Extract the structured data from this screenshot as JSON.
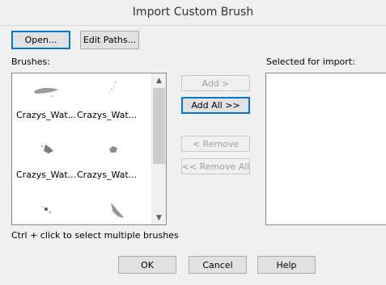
{
  "window": {
    "title": "Import Custom Brush"
  },
  "toolbar": {
    "open_label": "Open...",
    "edit_paths_label": "Edit Paths..."
  },
  "brushes": {
    "label": "Brushes:",
    "items": [
      {
        "name": "Crazys_Wat...",
        "icon": "brush-stroke-thumbnail"
      },
      {
        "name": "Crazys_Wat...",
        "icon": "brush-splatter-thumbnail"
      },
      {
        "name": "Crazys_Wat...",
        "icon": "brush-blot-thumbnail"
      },
      {
        "name": "Crazys_Wat...",
        "icon": "brush-blot-thumbnail"
      },
      {
        "name": "",
        "icon": "brush-dots-thumbnail"
      },
      {
        "name": "",
        "icon": "brush-streak-thumbnail"
      }
    ],
    "hint": "Ctrl + click to select multiple brushes"
  },
  "transfer": {
    "add_label": "Add >",
    "add_all_label": "Add All >>",
    "remove_label": "< Remove",
    "remove_all_label": "<< Remove All"
  },
  "selected": {
    "label": "Selected for import:"
  },
  "footer": {
    "ok_label": "OK",
    "cancel_label": "Cancel",
    "help_label": "Help"
  },
  "colors": {
    "focus": "#0078d7",
    "disabled_text": "#a0a0a0"
  }
}
